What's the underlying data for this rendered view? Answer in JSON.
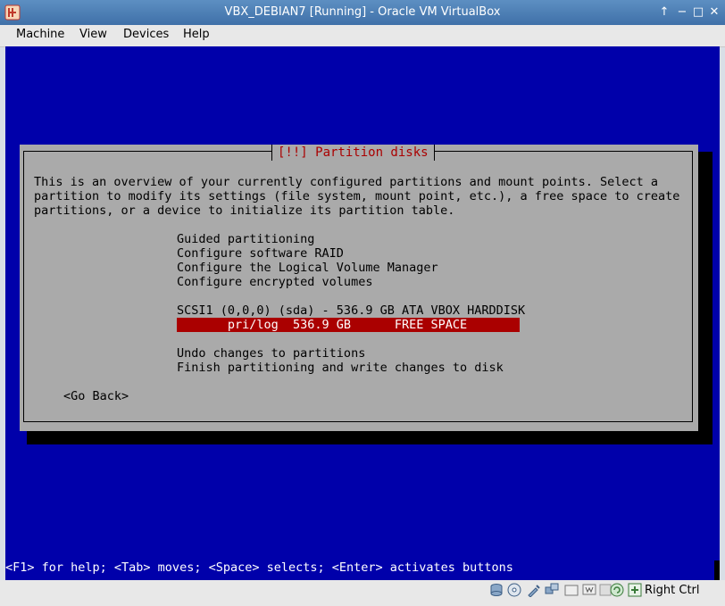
{
  "window": {
    "title": "VBX_DEBIAN7 [Running] - Oracle VM VirtualBox",
    "controls": [
      "↑",
      "−",
      "□",
      "✕"
    ]
  },
  "menubar": {
    "items": [
      "Machine",
      "View",
      "Devices",
      "Help"
    ]
  },
  "installer": {
    "title": "[!!] Partition disks",
    "description": [
      "This is an overview of your currently configured partitions and mount points. Select a",
      "partition to modify its settings (file system, mount point, etc.), a free space to create",
      "partitions, or a device to initialize its partition table."
    ],
    "options": [
      "Guided partitioning",
      "Configure software RAID",
      "Configure the Logical Volume Manager",
      "Configure encrypted volumes"
    ],
    "disk": "SCSI1 (0,0,0) (sda) - 536.9 GB ATA VBOX HARDDISK",
    "selected_partition": "       pri/log  536.9 GB      FREE SPACE",
    "actions": [
      "Undo changes to partitions",
      "Finish partitioning and write changes to disk"
    ],
    "go_back": "<Go Back>",
    "help_line": "<F1> for help; <Tab> moves; <Space> selects; <Enter> activates buttons"
  },
  "statusbar": {
    "icons": [
      "hard-disk-icon",
      "optical-drive-icon",
      "usb-icon",
      "network-icon",
      "shared-folders-icon",
      "display-icon",
      "video-capture-icon",
      "mouse-integration-icon",
      "host-key-icon"
    ],
    "host_key": "Right Ctrl"
  },
  "colors": {
    "screen_bg": "#0000aa",
    "dialog_bg": "#aaaaaa",
    "highlight": "#aa0000",
    "title_text": "#aa0000"
  }
}
